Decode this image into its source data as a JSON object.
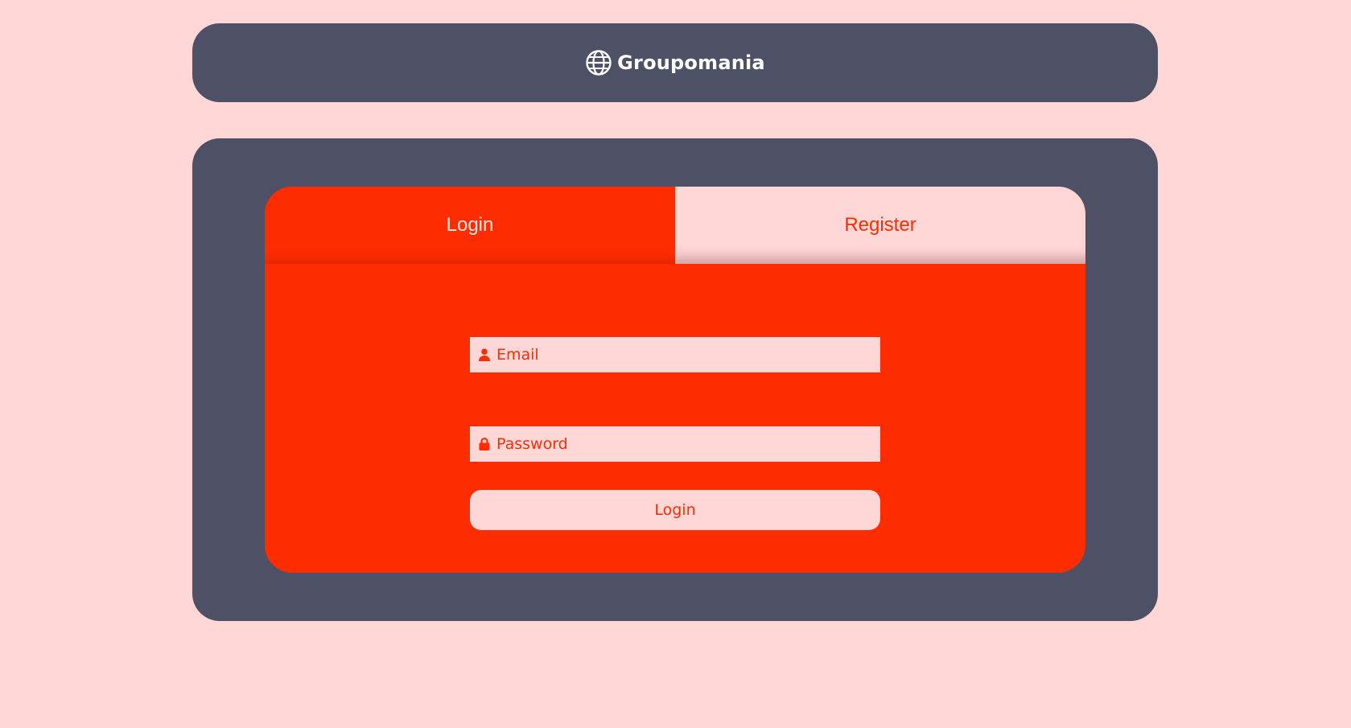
{
  "header": {
    "brand_name": "Groupomania",
    "brand_icon": "globe-icon"
  },
  "auth": {
    "tabs": [
      {
        "label": "Login",
        "active": true
      },
      {
        "label": "Register",
        "active": false
      }
    ],
    "email": {
      "placeholder": "Email",
      "value": "",
      "icon": "user-icon"
    },
    "password": {
      "placeholder": "Password",
      "value": "",
      "icon": "lock-icon"
    },
    "submit_label": "Login"
  },
  "colors": {
    "background": "#ffd7d7",
    "panel": "#4e5166",
    "accent": "#fd2d01",
    "text_light": "#ffffff"
  }
}
